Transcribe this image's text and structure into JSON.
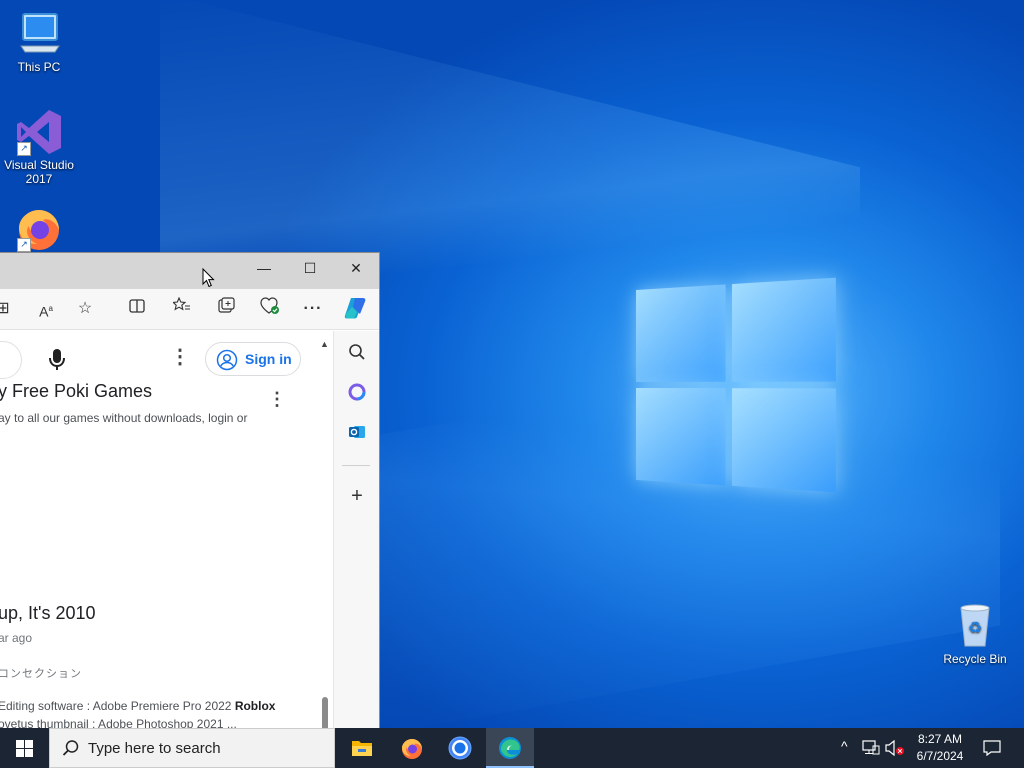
{
  "desktop": {
    "icons": [
      {
        "label": "This PC"
      },
      {
        "label": "Visual Studio 2017"
      },
      {
        "label": "Firefox"
      },
      {
        "label": "Recycle Bin"
      }
    ]
  },
  "browser": {
    "window_controls": {
      "minimize": "—",
      "maximize": "☐",
      "close": "✕"
    },
    "toolbar": {
      "more": "···"
    },
    "page": {
      "signin_label": "Sign in",
      "results": [
        {
          "title": "y Free Poki Games",
          "snippet": "ay to all our games without downloads, login or"
        },
        {
          "title": "up, It's 2010",
          "meta": "ar ago",
          "tag": "コンセクション",
          "line1_plain": "Editing software : Adobe Premiere Pro 2022 ",
          "line1_bold": "Roblox",
          "line2": "ovetus thumbnail : Adobe Photoshop 2021 ..."
        }
      ]
    }
  },
  "taskbar": {
    "search_placeholder": "Type here to search",
    "clock_time": "8:27 AM",
    "clock_date": "6/7/2024"
  }
}
